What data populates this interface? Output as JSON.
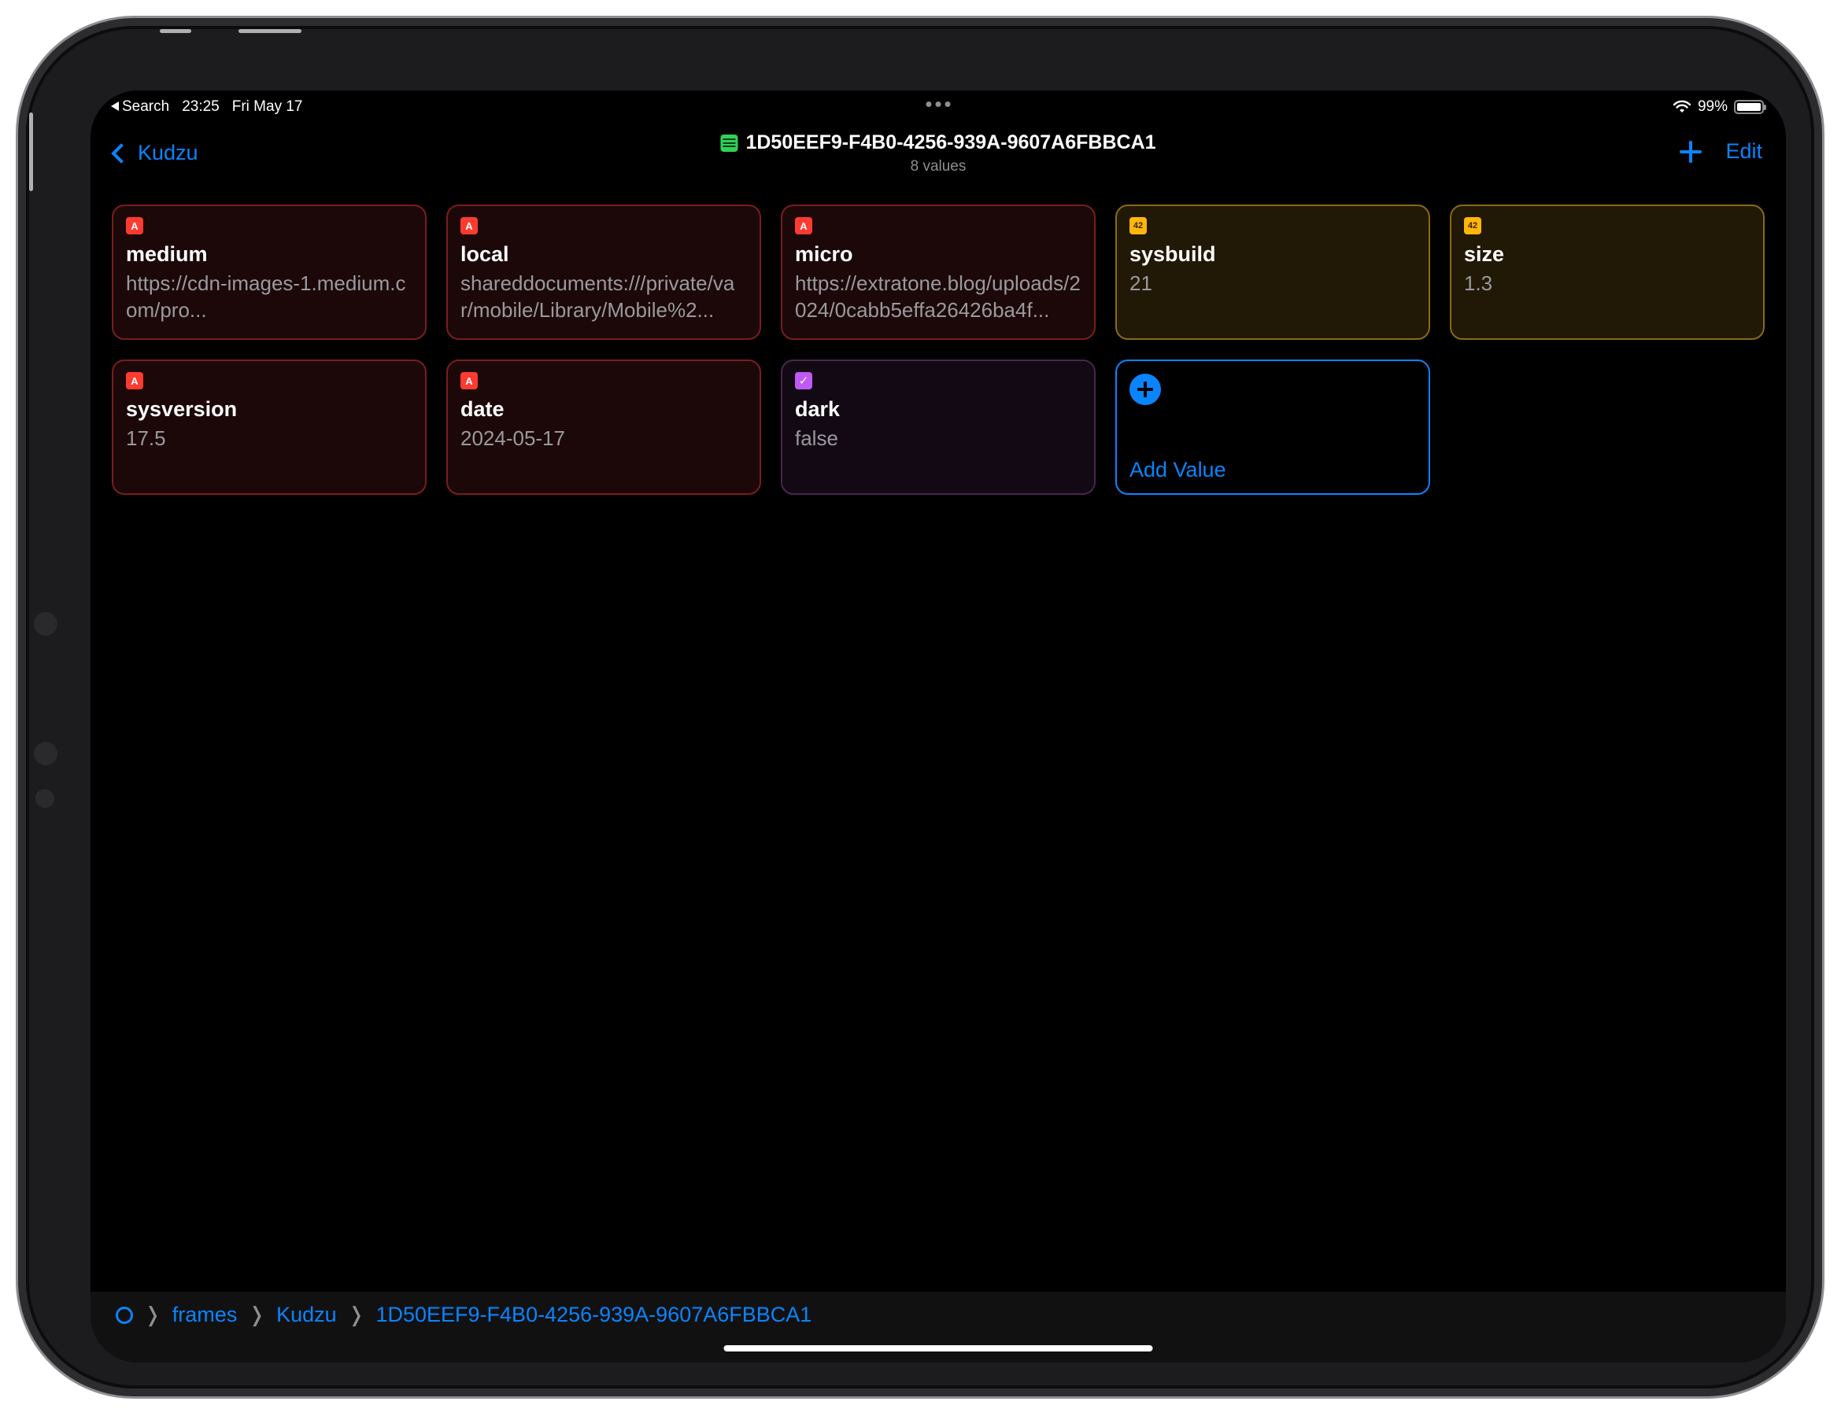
{
  "status_bar": {
    "back_app": "Search",
    "time": "23:25",
    "date": "Fri May 17",
    "battery": "99%"
  },
  "nav": {
    "back_label": "Kudzu",
    "title": "1D50EEF9-F4B0-4256-939A-9607A6FBBCA1",
    "subtitle": "8 values",
    "edit_label": "Edit"
  },
  "values": [
    {
      "type": "text",
      "badge": "A",
      "key": "medium",
      "value": "https://cdn-images-1.medium.com/pro..."
    },
    {
      "type": "text",
      "badge": "A",
      "key": "local",
      "value": "shareddocuments:///private/var/mobile/Library/Mobile%2..."
    },
    {
      "type": "text",
      "badge": "A",
      "key": "micro",
      "value": "https://extratone.blog/uploads/2024/0cabb5effa26426ba4f..."
    },
    {
      "type": "number",
      "badge": "42",
      "key": "sysbuild",
      "value": "21"
    },
    {
      "type": "number",
      "badge": "42",
      "key": "size",
      "value": "1.3"
    },
    {
      "type": "text",
      "badge": "A",
      "key": "sysversion",
      "value": "17.5"
    },
    {
      "type": "text",
      "badge": "A",
      "key": "date",
      "value": "2024-05-17"
    },
    {
      "type": "boolean",
      "badge": "✓",
      "key": "dark",
      "value": "false"
    }
  ],
  "add_value_label": "Add Value",
  "breadcrumb": [
    "frames",
    "Kudzu",
    "1D50EEF9-F4B0-4256-939A-9607A6FBBCA1"
  ],
  "colors": {
    "accent": "#0a84ff",
    "text_type": "#ff3b30",
    "number_type": "#ffb60a",
    "boolean_type": "#bf5af2",
    "table_icon": "#30d158"
  }
}
